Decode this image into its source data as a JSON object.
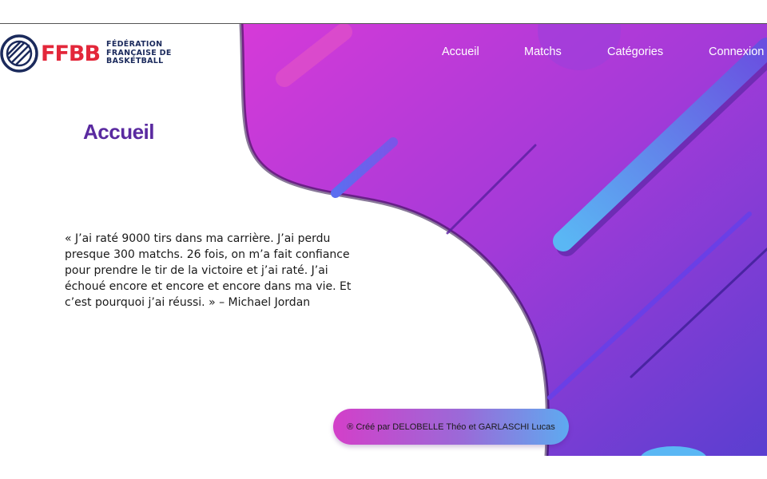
{
  "brand": {
    "abbr": "FFBB",
    "name_lines": [
      "FÉDÉRATION",
      "FRANÇAISE DE",
      "BASKETBALL"
    ]
  },
  "nav": {
    "items": [
      {
        "label": "Accueil"
      },
      {
        "label": "Matchs"
      },
      {
        "label": "Catégories"
      },
      {
        "label": "Connexion"
      }
    ]
  },
  "main": {
    "title": "Accueil",
    "quote": "« J’ai raté 9000 tirs dans ma carrière. J’ai perdu presque 300 matchs. 26 fois, on m’a fait confiance pour prendre le tir de la victoire et j’ai raté. J’ai échoué encore et encore et encore dans ma vie. Et c’est pourquoi j’ai réussi. » – Michael Jordan"
  },
  "footer": {
    "credit": "® Créé par DELOBELLE Théo et GARLASCHI Lucas"
  },
  "colors": {
    "gradient_start": "#cf3fd6",
    "gradient_end": "#5a3fd0",
    "title": "#5a2aa0",
    "brand_red": "#e3273a",
    "brand_navy": "#1b2a5c",
    "accent_blue": "#5eaaf0"
  }
}
